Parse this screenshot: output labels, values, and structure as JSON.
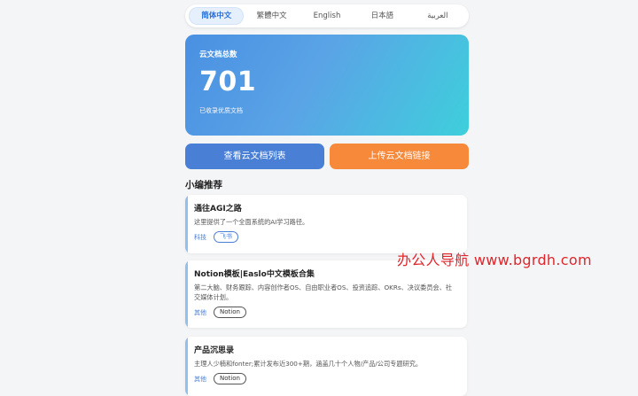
{
  "lang_tabs": [
    {
      "label": "简体中文",
      "active": true
    },
    {
      "label": "繁體中文",
      "active": false
    },
    {
      "label": "English",
      "active": false
    },
    {
      "label": "日本語",
      "active": false
    },
    {
      "label": "العربية",
      "active": false
    }
  ],
  "stats": {
    "label": "云文档总数",
    "value": "701",
    "subtitle": "已收录优质文档"
  },
  "buttons": {
    "view_list": "查看云文档列表",
    "upload": "上传云文档链接"
  },
  "section": {
    "title": "小编推荐"
  },
  "items": [
    {
      "title": "通往AGI之路",
      "desc": "这里提供了一个全面系统的AI学习路径。",
      "category": "科技",
      "tag": "飞书"
    },
    {
      "title": "Notion模板|Easlo中文模板合集",
      "desc": "第二大脑、财务跟踪、内容创作者OS、自由职业者OS、投资追踪、OKRs、决议委员会、社交媒体计划。",
      "category": "其他",
      "tag": "Notion"
    },
    {
      "title": "产品沉思录",
      "desc": "主理人少楠和fonter;累计发布近300+期，涵盖几十个人物/产品/公司专题研究。",
      "category": "其他",
      "tag": "Notion"
    }
  ],
  "watermark": "办公人导航  www.bgrdh.com",
  "colors": {
    "accent_blue": "#4a7fd6",
    "accent_orange": "#f7893a",
    "watermark_red": "#e0262b"
  }
}
